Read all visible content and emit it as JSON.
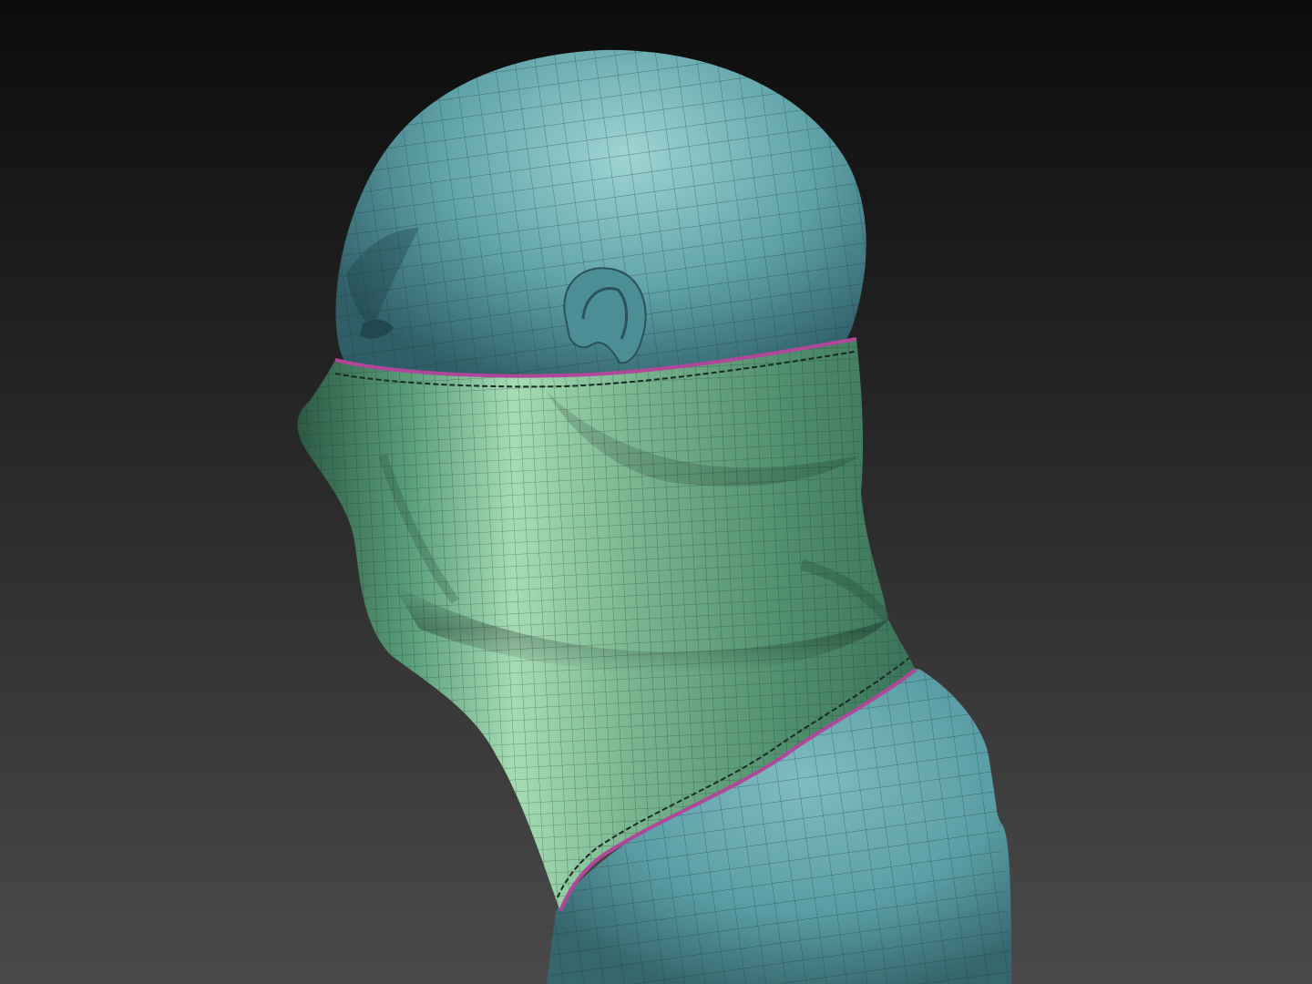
{
  "scene": {
    "subject": "head-sculpt-with-neck-gaiter",
    "colors": {
      "background_top": "#0c0c0c",
      "background_bottom": "#4a4a4a",
      "skin": "#5fa3a9",
      "skin_highlight": "#9fd4d3",
      "skin_shadow": "#2f5e66",
      "cloth": "#5a9e7a",
      "cloth_highlight": "#a6dcb4",
      "cloth_shadow": "#2c5a44",
      "wire": "#1d3338",
      "hem": "#b0479a",
      "stitch": "#1a2a24"
    }
  }
}
